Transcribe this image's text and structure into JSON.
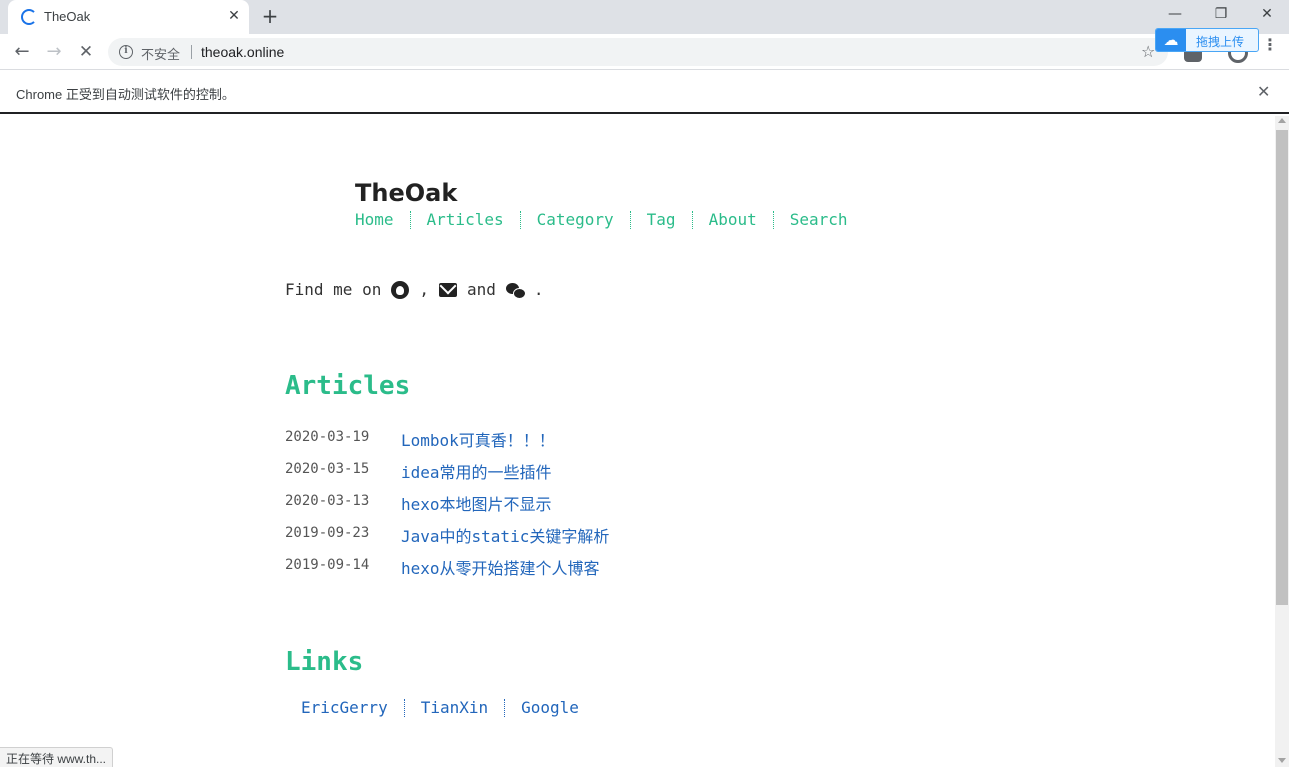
{
  "browser": {
    "tab": {
      "title": "TheOak",
      "close_label": "✕"
    },
    "new_tab_label": "+",
    "window": {
      "minimize": "—",
      "restore": "❐",
      "close": "✕"
    },
    "toolbar": {
      "back": "←",
      "forward": "→",
      "stop": "✕",
      "security_label": "不安全",
      "url": "theoak.online",
      "star": "☆",
      "menu": "⋮"
    },
    "extension": {
      "baidu_label": "拖拽上传"
    },
    "infobar": {
      "text": "Chrome 正受到自动测试软件的控制。",
      "close": "✕"
    },
    "status_text": "正在等待 www.th..."
  },
  "site": {
    "title": "TheOak",
    "nav": [
      "Home",
      "Articles",
      "Category",
      "Tag",
      "About",
      "Search"
    ],
    "find_me": {
      "prefix": "Find me on",
      "sep1": ",",
      "sep2": "and",
      "suffix": "."
    },
    "articles_heading": "Articles",
    "articles": [
      {
        "date": "2020-03-19",
        "title": "Lombok可真香！！！"
      },
      {
        "date": "2020-03-15",
        "title": "idea常用的一些插件"
      },
      {
        "date": "2020-03-13",
        "title": "hexo本地图片不显示"
      },
      {
        "date": "2019-09-23",
        "title": "Java中的static关键字解析"
      },
      {
        "date": "2019-09-14",
        "title": "hexo从零开始搭建个人博客"
      }
    ],
    "links_heading": "Links",
    "links": [
      "EricGerry",
      "TianXin",
      "Google"
    ]
  },
  "icons": {
    "find_me_icons": [
      "github-icon",
      "mail-icon",
      "wechat-icon"
    ]
  },
  "colors": {
    "accent_green": "#2bbc8a",
    "link_blue": "#2266bb"
  }
}
